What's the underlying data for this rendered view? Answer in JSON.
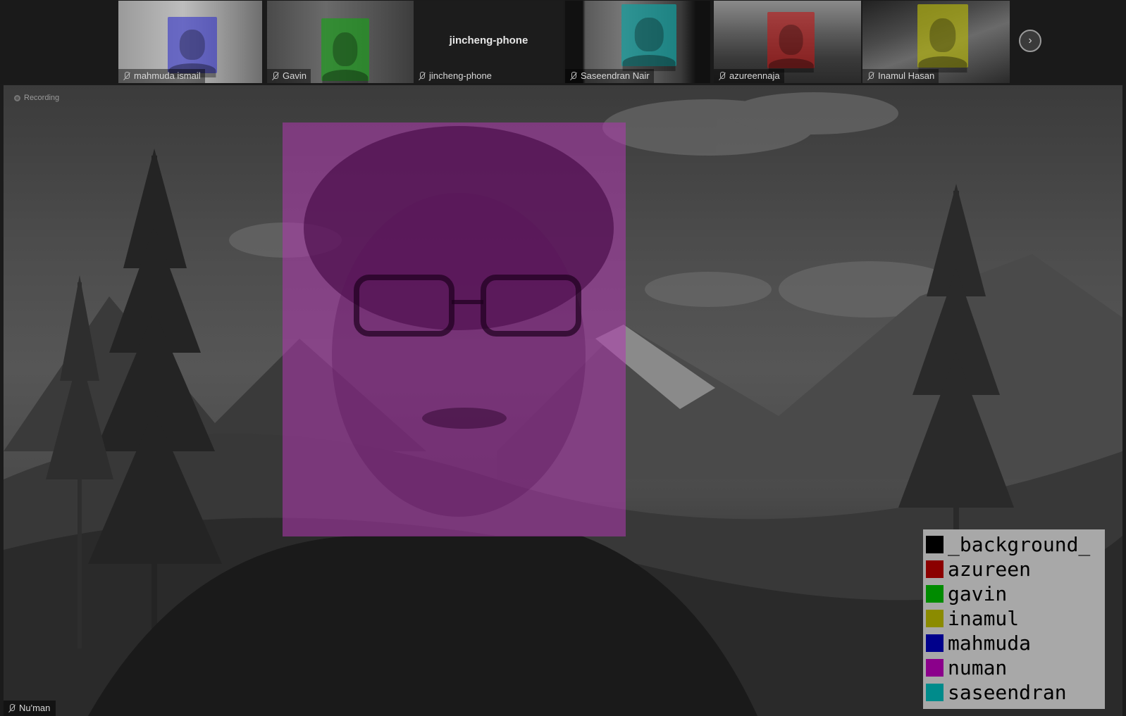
{
  "participants": [
    {
      "name": "mahmuda ismail",
      "color": "#3030c8"
    },
    {
      "name": "Gavin",
      "color": "#18a018"
    },
    {
      "name": "jincheng-phone",
      "center_label": "jincheng-phone"
    },
    {
      "name": "Saseendran Nair",
      "color": "#10a0a0"
    },
    {
      "name": "azureennaja",
      "color": "#c01818"
    },
    {
      "name": "Inamul Hasan",
      "color": "#b0b010"
    }
  ],
  "next_icon": "chevron-right-icon",
  "next_symbol": "›",
  "main": {
    "recording_label": "Recording",
    "speaker_name": "Nu'man",
    "highlight_color": "#b038b0"
  },
  "legend": [
    {
      "label": "_background_",
      "color": "#000000"
    },
    {
      "label": "azureen",
      "color": "#8b0000"
    },
    {
      "label": "gavin",
      "color": "#008b00"
    },
    {
      "label": "inamul",
      "color": "#8b8b00"
    },
    {
      "label": "mahmuda",
      "color": "#00008b"
    },
    {
      "label": "numan",
      "color": "#8b008b"
    },
    {
      "label": "saseendran",
      "color": "#008b8b"
    }
  ]
}
